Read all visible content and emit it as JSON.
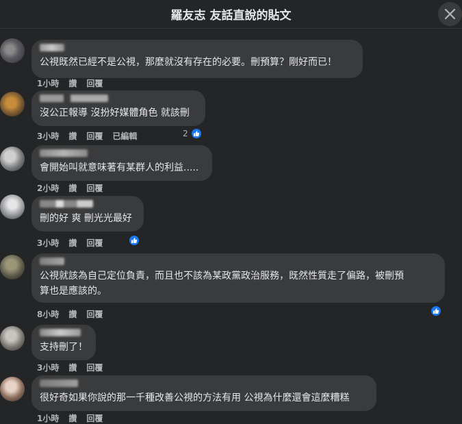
{
  "header": {
    "title": "羅友志 友話直說的貼文"
  },
  "comments": [
    {
      "text": "公視既然已經不是公視，那麼就沒有存在的必要。刪預算？剛好而已！",
      "time": "1小時",
      "like": "讚",
      "reply": "回覆",
      "edited": "",
      "reactions": ""
    },
    {
      "text": "沒公正報導 沒扮好媒體角色 就該刪",
      "time": "3小時",
      "like": "讚",
      "reply": "回覆",
      "edited": "已編輯",
      "reactions": "2"
    },
    {
      "text": "會開始叫就意味著有某群人的利益.....",
      "time": "2小時",
      "like": "讚",
      "reply": "回覆",
      "edited": "",
      "reactions": ""
    },
    {
      "text": "刪的好 爽 刪光光最好",
      "time": "3小時",
      "like": "讚",
      "reply": "回覆",
      "edited": "",
      "reactions": ""
    },
    {
      "text": "公視就該為自己定位負責，而且也不該為某政黨政治服務，既然性質走了偏路，被刪預\n算也是應該的。",
      "time": "8小時",
      "like": "讚",
      "reply": "回覆",
      "edited": "",
      "reactions": ""
    },
    {
      "text": "支持刪了！",
      "time": "3小時",
      "like": "讚",
      "reply": "回覆",
      "edited": "",
      "reactions": ""
    },
    {
      "text": "很好奇如果你說的那一千種改善公視的方法有用 公視為什麼還會這麼糟糕",
      "time": "1小時",
      "like": "讚",
      "reply": "回覆",
      "edited": "",
      "reactions": ""
    }
  ]
}
